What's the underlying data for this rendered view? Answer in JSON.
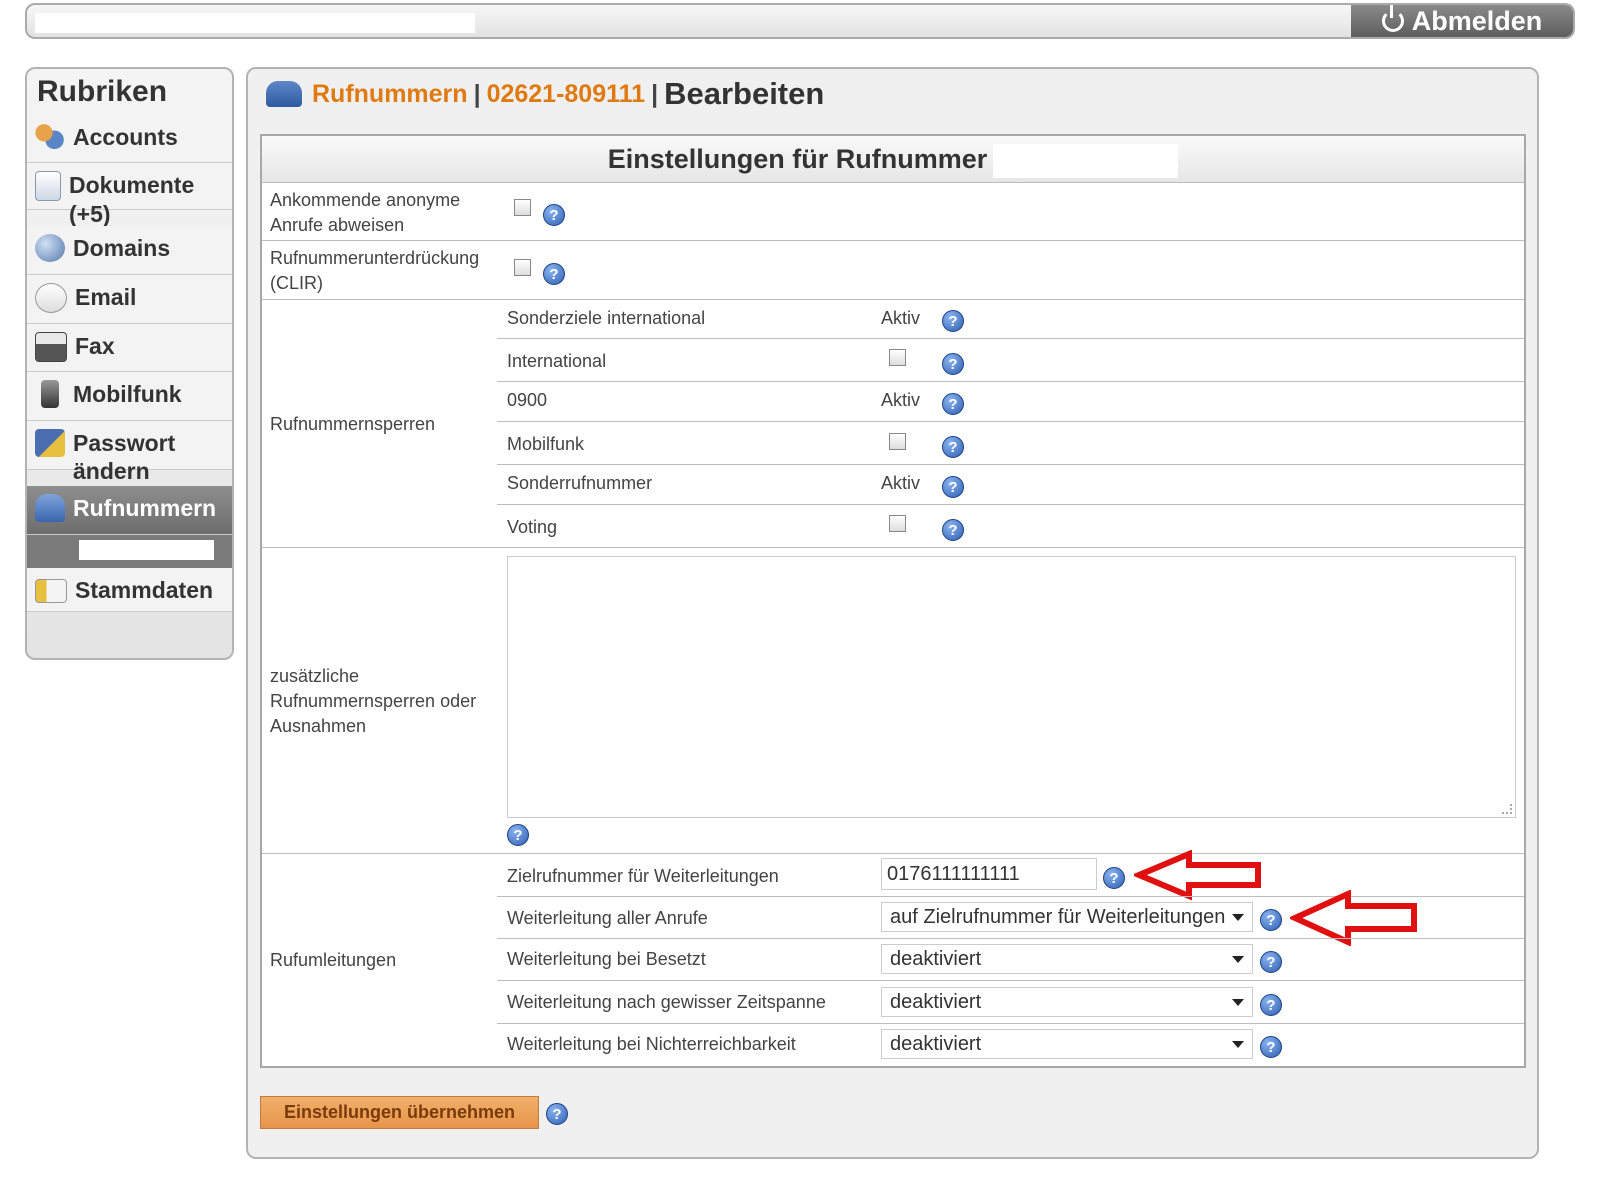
{
  "topbar": {
    "logout_label": "Abmelden"
  },
  "sidebar": {
    "title": "Rubriken",
    "items": [
      {
        "label": "Accounts",
        "icon": "users-icon"
      },
      {
        "label": "Dokumente (+5)",
        "icon": "document-icon"
      },
      {
        "label": "Domains",
        "icon": "globe-icon"
      },
      {
        "label": "Email",
        "icon": "email-icon"
      },
      {
        "label": "Fax",
        "icon": "fax-icon"
      },
      {
        "label": "Mobilfunk",
        "icon": "mobile-phone-icon"
      },
      {
        "label": "Passwort ändern",
        "icon": "lock-icon"
      },
      {
        "label": "Rufnummern",
        "icon": "telephone-icon",
        "active": true
      },
      {
        "label": "Stammdaten",
        "icon": "id-card-icon"
      }
    ]
  },
  "breadcrumb": {
    "section": "Rufnummern",
    "sep1": "|",
    "number": "02621-809111",
    "sep2": "|",
    "title": "Bearbeiten"
  },
  "settings": {
    "header": "Einstellungen für Rufnummer",
    "anon_label": "Ankommende anonyme Anrufe abweisen",
    "clir_label": "Rufnummerunterdrückung (CLIR)",
    "sperren_label": "Rufnummernsperren",
    "sperren": [
      {
        "label": "Sonderziele international",
        "state": "Aktiv"
      },
      {
        "label": "International",
        "state": ""
      },
      {
        "label": "0900",
        "state": "Aktiv"
      },
      {
        "label": "Mobilfunk",
        "state": ""
      },
      {
        "label": "Sonderrufnummer",
        "state": "Aktiv"
      },
      {
        "label": "Voting",
        "state": ""
      }
    ],
    "extra_label": "zusätzliche Rufnummernsperren oder Ausnahmen",
    "umleitungen_label": "Rufumleitungen",
    "ziel_label": "Zielrufnummer für Weiterleitungen",
    "ziel_value": "0176111111111",
    "alle_label": "Weiterleitung aller Anrufe",
    "alle_value": "auf Zielrufnummer für Weiterleitungen",
    "besetzt_label": "Weiterleitung bei Besetzt",
    "besetzt_value": "deaktiviert",
    "zeit_label": "Weiterleitung nach gewisser Zeitspanne",
    "zeit_value": "deaktiviert",
    "nicht_label": "Weiterleitung bei Nichterreichbarkeit",
    "nicht_value": "deaktiviert",
    "submit_label": "Einstellungen übernehmen",
    "help_glyph": "?"
  },
  "colors": {
    "accent_orange": "#e07a10",
    "arrow_red": "#e01010",
    "help_blue": "#2f5fb0"
  }
}
